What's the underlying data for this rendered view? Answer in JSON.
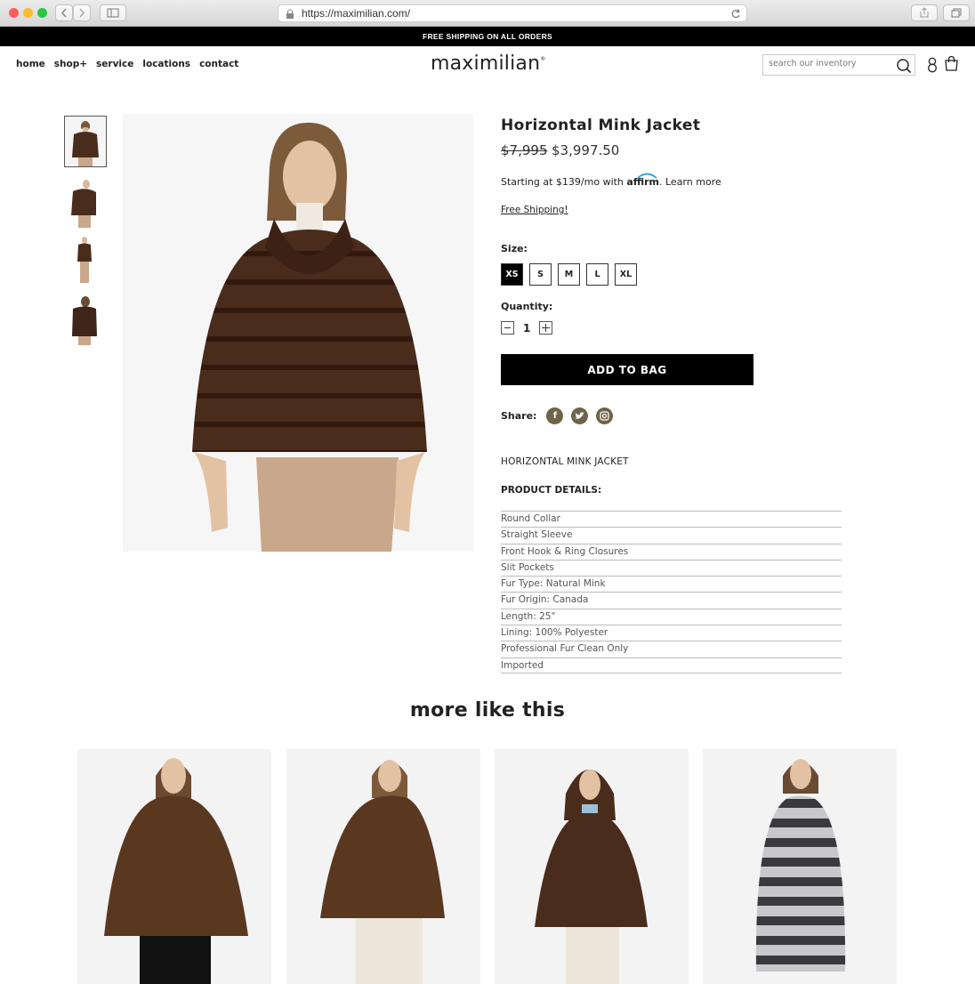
{
  "browser": {
    "url": "https://maximilian.com/"
  },
  "promo_bar": {
    "text": "FREE SHIPPING ON ALL ORDERS"
  },
  "header": {
    "nav": [
      "home",
      "shop+",
      "service",
      "locations",
      "contact"
    ],
    "logo": "maximilian",
    "logo_mark": "®",
    "search_placeholder": "search our inventory"
  },
  "product": {
    "title": "Horizontal Mink Jacket",
    "old_price": "$7,995",
    "price": "$3,997.50",
    "affirm_prefix": "Starting at $139/mo with",
    "affirm_brand": "affirm",
    "affirm_suffix": ". Learn more",
    "free_shipping": "Free Shipping!",
    "size_label": "Size:",
    "sizes": [
      "XS",
      "S",
      "M",
      "L",
      "XL"
    ],
    "selected_size": "XS",
    "quantity_label": "Quantity:",
    "quantity": "1",
    "add_to_bag": "ADD TO BAG",
    "share_label": "Share:",
    "name_caps": "HORIZONTAL MINK JACKET",
    "details_heading": "PRODUCT DETAILS:",
    "details": [
      "Round Collar",
      "Straight Sleeve",
      "Front Hook & Ring Closures",
      "Slit Pockets",
      "Fur Type: Natural Mink",
      "Fur Origin: Canada",
      "Length: 25\"",
      "Lining: 100% Polyester",
      "Professional Fur Clean Only",
      "Imported"
    ]
  },
  "related": {
    "heading": "more like this"
  },
  "colors": {
    "accent": "#000000",
    "share_icon": "#6f6448",
    "fur_brown": "#4a2c1c",
    "pants_tan": "#c9a78a"
  }
}
